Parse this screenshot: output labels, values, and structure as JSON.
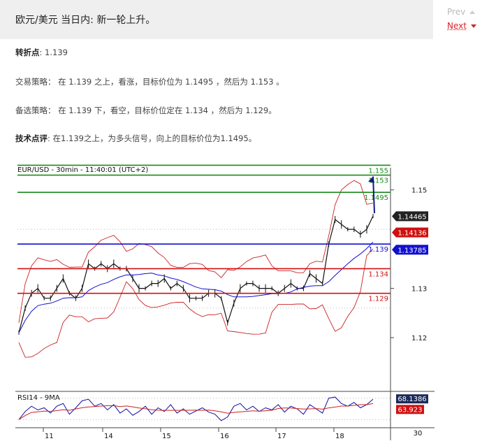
{
  "header": {
    "title": "欧元/美元 当日内: 新一轮上升。",
    "prev": "Prev",
    "next": "Next"
  },
  "content": {
    "pivot_label": "转折点",
    "pivot_value": ": 1.139",
    "strategy_label": "交易策略：",
    "strategy_text": " 在 1.139 之上，看涨，目标价位为 1.1495 ，然后为 1.153 。",
    "alt_label": "备选策略：",
    "alt_text": " 在 1.139 下，看空，目标价位定在 1.134 ，然后为 1.129。",
    "comment_label": "技术点评",
    "comment_text": ": 在1.139之上，为多头信号，向上的目标价位为1.1495。"
  },
  "colors": {
    "green": "#1a8a1a",
    "red": "#d01010",
    "blue": "#1010d0",
    "accent": "#d8212c"
  },
  "chart_data": {
    "type": "line",
    "title": "EUR/USD - 30min - 11:40:01 (UTC+2)",
    "ylim": [
      1.1105,
      1.1545
    ],
    "y_ticks": [
      "1.15",
      "1.13",
      "1.12"
    ],
    "y_tick_values": [
      1.15,
      1.13,
      1.12
    ],
    "x_ticks": [
      "11",
      "14",
      "15",
      "16",
      "17",
      "18"
    ],
    "levels": [
      {
        "label": "1.155",
        "value": 1.155,
        "color": "green"
      },
      {
        "label": "1.153",
        "value": 1.153,
        "color": "green"
      },
      {
        "label": "1.1495",
        "value": 1.1495,
        "color": "green"
      },
      {
        "label": "1.139",
        "value": 1.139,
        "color": "blue"
      },
      {
        "label": "1.134",
        "value": 1.134,
        "color": "red"
      },
      {
        "label": "1.129",
        "value": 1.129,
        "color": "red"
      }
    ],
    "price_tags": [
      {
        "label": "1.14465",
        "value": 1.14465,
        "style": "dark"
      },
      {
        "label": "1.14136",
        "value": 1.14136,
        "style": "red"
      },
      {
        "label": "1.13785",
        "value": 1.13785,
        "style": "blue"
      }
    ],
    "series": [
      {
        "values": [
          1.121,
          1.126,
          1.129,
          1.13,
          1.128,
          1.128,
          1.13,
          1.132,
          1.129,
          1.128,
          1.13,
          1.135,
          1.134,
          1.135,
          1.134,
          1.135,
          1.134,
          1.134,
          1.132,
          1.13,
          1.13,
          1.131,
          1.131,
          1.132,
          1.13,
          1.131,
          1.13,
          1.128,
          1.128,
          1.128,
          1.129,
          1.129,
          1.128,
          1.123,
          1.127,
          1.13,
          1.131,
          1.131,
          1.13,
          1.13,
          1.13,
          1.129,
          1.13,
          1.131,
          1.13,
          1.13,
          1.133,
          1.132,
          1.131,
          1.139,
          1.144,
          1.143,
          1.142,
          1.142,
          1.141,
          1.142,
          1.1447
        ]
      }
    ],
    "rsi": {
      "label": "RSI14 - 9MA",
      "value_label": "68.1386",
      "ma_label": "63.923",
      "axis_label": "30",
      "values": [
        30,
        45,
        55,
        48,
        52,
        42,
        55,
        60,
        40,
        52,
        65,
        68,
        55,
        60,
        48,
        58,
        42,
        50,
        38,
        45,
        55,
        40,
        52,
        45,
        58,
        42,
        50,
        40,
        46,
        52,
        44,
        40,
        28,
        35,
        55,
        60,
        48,
        55,
        45,
        52,
        48,
        58,
        44,
        55,
        50,
        40,
        58,
        50,
        42,
        70,
        72,
        60,
        55,
        62,
        52,
        58,
        68
      ]
    }
  }
}
